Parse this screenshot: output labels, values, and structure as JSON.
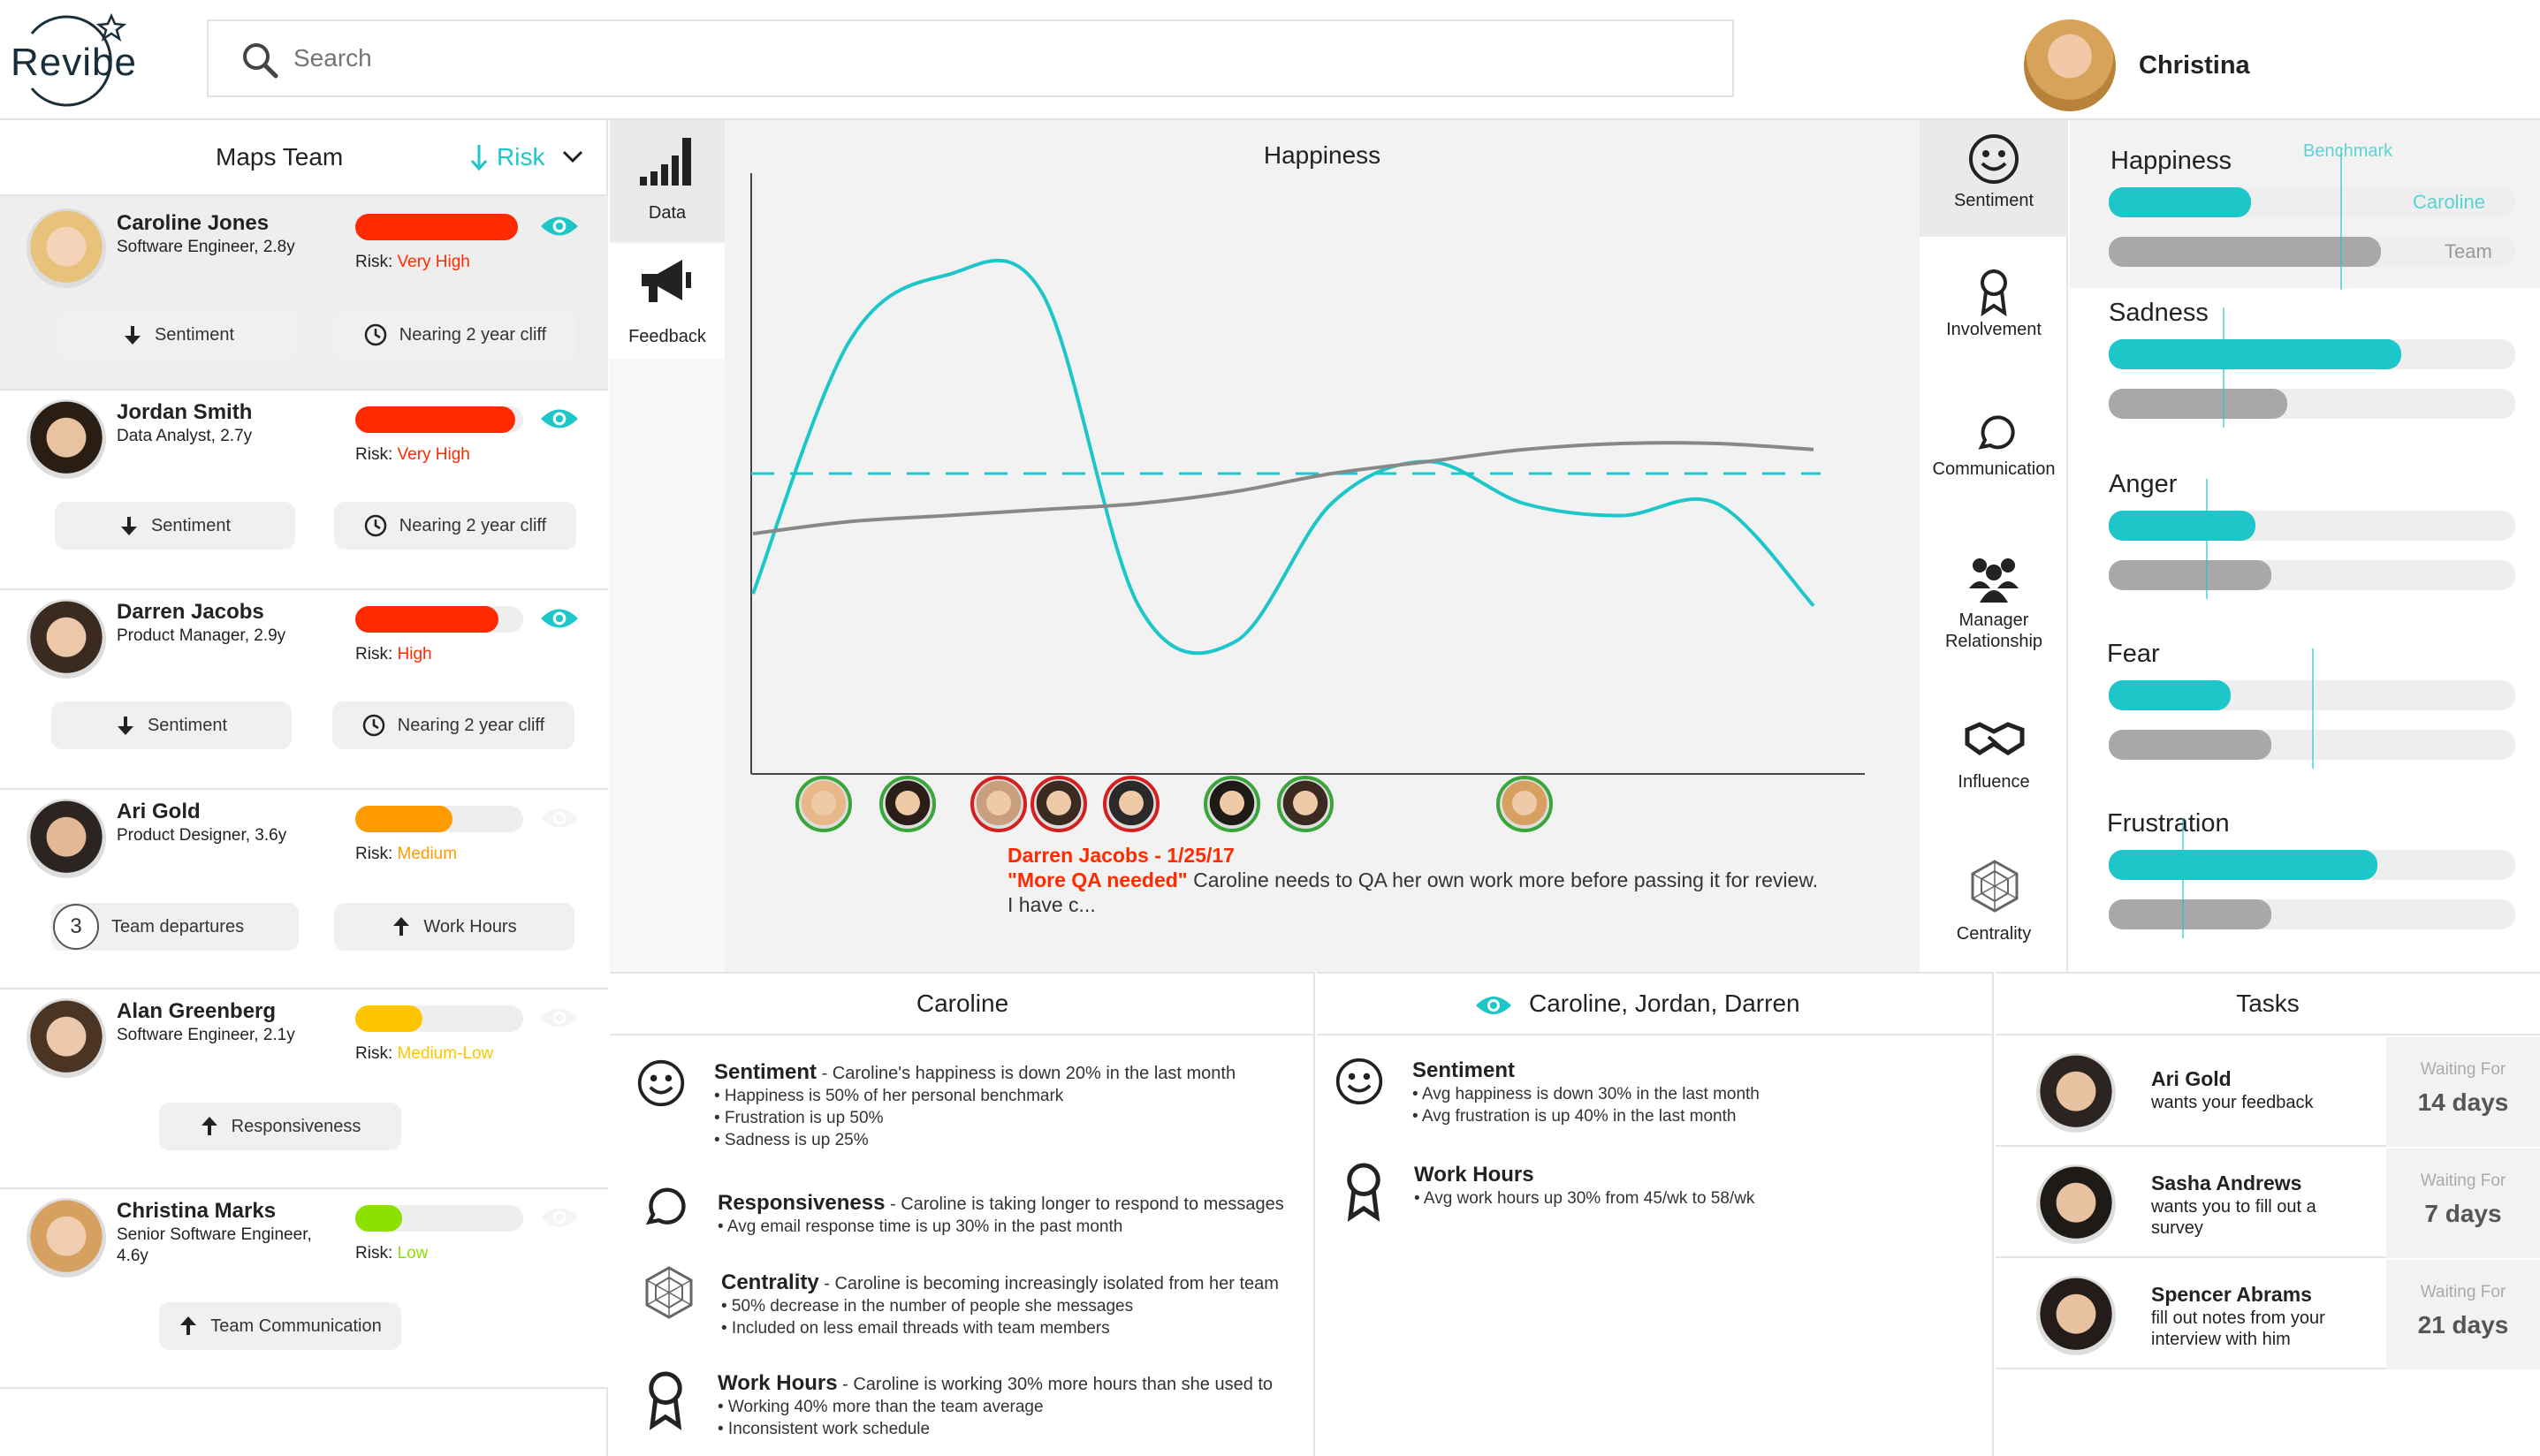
{
  "app": {
    "logo_text": "Revibe"
  },
  "search": {
    "placeholder": "Search"
  },
  "user": {
    "name": "Christina"
  },
  "team_panel": {
    "title": "Maps Team",
    "sort_label": "Risk",
    "members": [
      {
        "name": "Caroline Jones",
        "role": "Software Engineer, 2.8y",
        "risk_prefix": "Risk: ",
        "risk": "Very High",
        "risk_level": 0.97,
        "risk_color": "#ff2a00",
        "watched": true,
        "chip1": "Sentiment",
        "chip2": "Nearing 2 year cliff"
      },
      {
        "name": "Jordan Smith",
        "role": "Data Analyst, 2.7y",
        "risk_prefix": "Risk: ",
        "risk": "Very High",
        "risk_level": 0.95,
        "risk_color": "#ff2a00",
        "watched": true,
        "chip1": "Sentiment",
        "chip2": "Nearing 2 year cliff"
      },
      {
        "name": "Darren Jacobs",
        "role": "Product Manager, 2.9y",
        "risk_prefix": "Risk: ",
        "risk": "High",
        "risk_level": 0.85,
        "risk_color": "#ff2a00",
        "watched": true,
        "chip1": "Sentiment",
        "chip2": "Nearing 2 year cliff"
      },
      {
        "name": "Ari Gold",
        "role": "Product Designer, 3.6y",
        "risk_prefix": "Risk: ",
        "risk": "Medium",
        "risk_level": 0.58,
        "risk_color": "#ff9a00",
        "watched": false,
        "chip_count": "3",
        "chip1": "Team departures",
        "chip2": "Work Hours"
      },
      {
        "name": "Alan Greenberg",
        "role": "Software Engineer, 2.1y",
        "risk_prefix": "Risk: ",
        "risk": "Medium-Low",
        "risk_level": 0.4,
        "risk_color": "#ffc400",
        "watched": false,
        "chip1": "Responsiveness"
      },
      {
        "name": "Christina Marks",
        "role_line1": "Senior Software Engineer,",
        "role_line2": "4.6y",
        "risk_prefix": "Risk: ",
        "risk": "Low",
        "risk_level": 0.28,
        "risk_color": "#8ee000",
        "watched": false,
        "chip1": "Team Communication"
      }
    ]
  },
  "tool_rail": {
    "data_label": "Data",
    "feedback_label": "Feedback"
  },
  "chart": {
    "title": "Happiness",
    "feedback": {
      "author": "Darren Jacobs - 1/25/17",
      "quote": "\"More QA needed\"",
      "text": " Caroline needs to QA her own work more before passing it for review.",
      "text2": "I have c..."
    }
  },
  "chart_data": {
    "type": "line",
    "title": "Happiness",
    "series": [
      {
        "color": "#1cc6c9",
        "values": [
          0.3,
          0.72,
          0.83,
          0.8,
          0.28,
          0.22,
          0.45,
          0.52,
          0.45,
          0.43,
          0.45,
          0.28
        ]
      },
      {
        "color": "#888888",
        "values": [
          0.4,
          0.42,
          0.43,
          0.44,
          0.45,
          0.47,
          0.5,
          0.52,
          0.54,
          0.55,
          0.55,
          0.54
        ]
      }
    ],
    "benchmark": 0.5,
    "benchmark_color": "#1cc6c9"
  },
  "categories": {
    "items": [
      "Sentiment",
      "Involvement",
      "Communication",
      "Manager Relationship",
      "Influence",
      "Centrality"
    ]
  },
  "metrics": {
    "benchmark_label": "Benchmark",
    "caroline_label": "Caroline",
    "team_label": "Team",
    "items": [
      {
        "name": "Happiness",
        "caroline": 0.35,
        "team": 0.67,
        "benchmark": 0.57
      },
      {
        "name": "Sadness",
        "caroline": 0.72,
        "team": 0.44,
        "benchmark": 0.28
      },
      {
        "name": "Anger",
        "caroline": 0.36,
        "team": 0.4,
        "benchmark": 0.24
      },
      {
        "name": "Fear",
        "caroline": 0.3,
        "team": 0.4,
        "benchmark": 0.5
      },
      {
        "name": "Frustration",
        "caroline": 0.66,
        "team": 0.4,
        "benchmark": 0.18
      }
    ]
  },
  "caroline_panel": {
    "title": "Caroline",
    "insights": [
      {
        "title": "Sentiment",
        "desc": " - Caroline's happiness is down 20% in the last month",
        "bullets": [
          "• Happiness is 50% of her personal benchmark",
          "• Frustration is up 50%",
          "• Sadness is up 25%"
        ]
      },
      {
        "title": "Responsiveness",
        "desc": " - Caroline is taking longer to respond to messages",
        "bullets": [
          "• Avg email response time is up 30% in the past month"
        ]
      },
      {
        "title": "Centrality",
        "desc": " - Caroline is becoming increasingly isolated from her team",
        "bullets": [
          "• 50% decrease in the number of people she messages",
          "• Included on less email threads with team members"
        ]
      },
      {
        "title": "Work Hours",
        "desc": " - Caroline is working 30% more hours than she used to",
        "bullets": [
          "• Working 40% more than the team average",
          "• Inconsistent work schedule"
        ]
      }
    ]
  },
  "group_panel": {
    "title": "Caroline, Jordan, Darren",
    "insights": [
      {
        "title": "Sentiment",
        "bullets": [
          "• Avg happiness is down 30% in the last month",
          "• Avg frustration is up 40% in the last month"
        ]
      },
      {
        "title": "Work Hours",
        "bullets": [
          "• Avg work hours up 30% from 45/wk to 58/wk"
        ]
      }
    ]
  },
  "tasks": {
    "title": "Tasks",
    "waiting_label": "Waiting For",
    "items": [
      {
        "name": "Ari Gold",
        "line1": "wants your feedback",
        "line2": "",
        "days": "14 days"
      },
      {
        "name": "Sasha Andrews",
        "line1": "wants you to fill out a",
        "line2": "survey",
        "days": "7 days"
      },
      {
        "name": "Spencer Abrams",
        "line1": "fill out notes from your",
        "line2": "interview with him",
        "days": "21 days"
      }
    ]
  }
}
